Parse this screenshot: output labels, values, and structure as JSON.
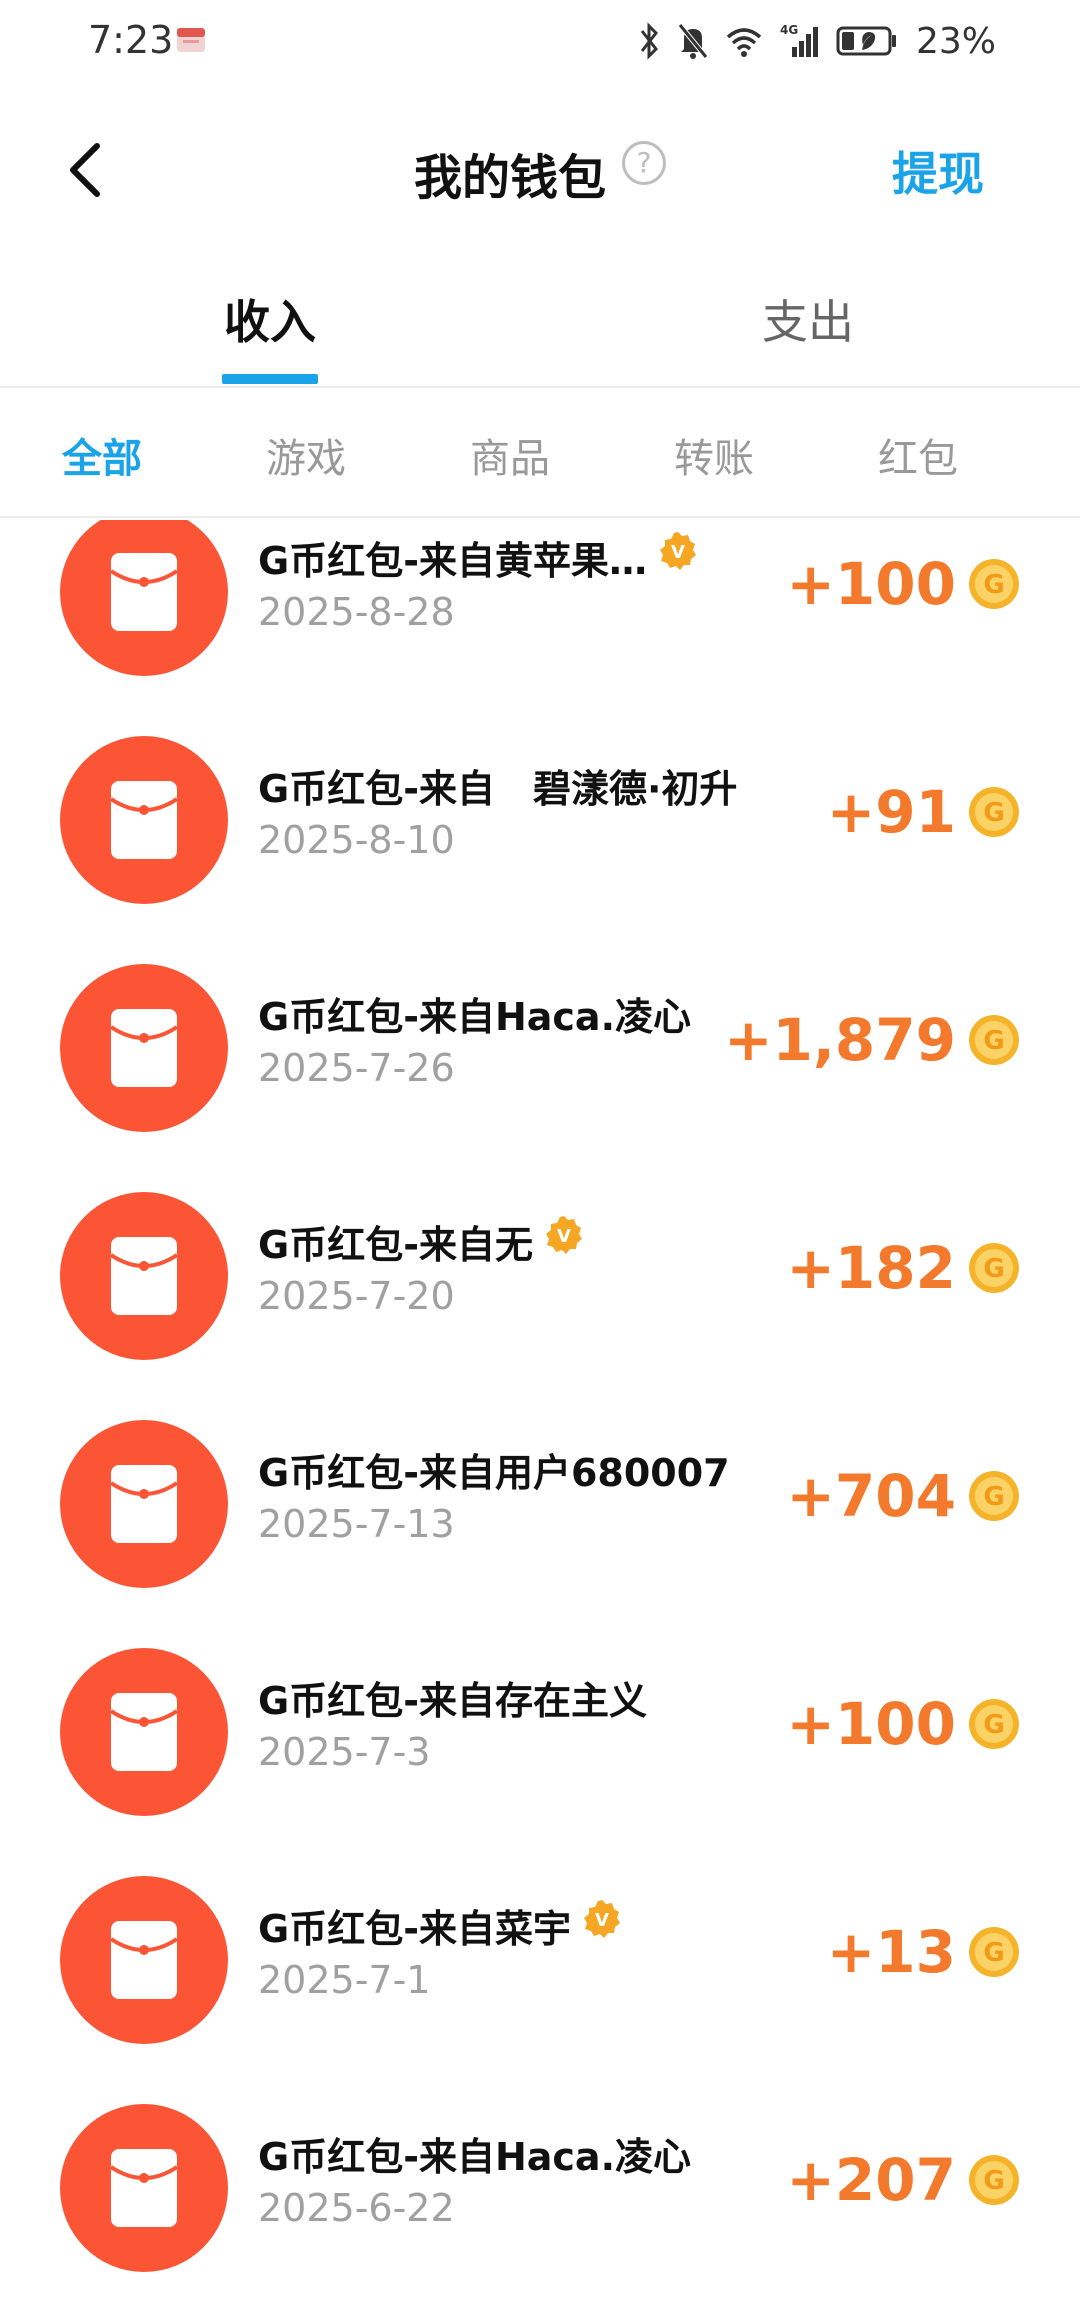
{
  "status_bar": {
    "time": "7:23",
    "battery_percent": "23%",
    "network": "4G"
  },
  "header": {
    "title": "我的钱包",
    "help_glyph": "?",
    "withdraw_label": "提现"
  },
  "main_tabs": [
    {
      "label": "收入",
      "active": true
    },
    {
      "label": "支出",
      "active": false
    }
  ],
  "sub_tabs": [
    {
      "label": "全部",
      "active": true
    },
    {
      "label": "游戏",
      "active": false
    },
    {
      "label": "商品",
      "active": false
    },
    {
      "label": "转账",
      "active": false
    },
    {
      "label": "红包",
      "active": false
    }
  ],
  "transactions": [
    {
      "title": "G币红包-来自黄苹果…",
      "date": "2025-8-28",
      "amount": "+100",
      "verified": true
    },
    {
      "title": "G币红包-来自　碧漾德·初升",
      "date": "2025-8-10",
      "amount": "+91",
      "verified": false
    },
    {
      "title": "G币红包-来自Haca.凌心",
      "date": "2025-7-26",
      "amount": "+1,879",
      "verified": false
    },
    {
      "title": "G币红包-来自无",
      "date": "2025-7-20",
      "amount": "+182",
      "verified": true
    },
    {
      "title": "G币红包-来自用户680007",
      "date": "2025-7-13",
      "amount": "+704",
      "verified": false
    },
    {
      "title": "G币红包-来自存在主义",
      "date": "2025-7-3",
      "amount": "+100",
      "verified": false
    },
    {
      "title": "G币红包-来自菜宇",
      "date": "2025-7-1",
      "amount": "+13",
      "verified": true
    },
    {
      "title": "G币红包-来自Haca.凌心",
      "date": "2025-6-22",
      "amount": "+207",
      "verified": false
    }
  ],
  "icons": {
    "back": "chevron-left-icon",
    "help": "question-circle-icon",
    "red_packet": "red-envelope-icon",
    "verified": "verified-badge-icon",
    "coin": "g-coin-icon"
  },
  "colors": {
    "accent": "#1aa3e8",
    "red_packet": "#fc5535",
    "amount": "#f37a2c",
    "coin": "#f5b32a",
    "badge": "#f5a623",
    "secondary_text": "#a0a0a0"
  }
}
